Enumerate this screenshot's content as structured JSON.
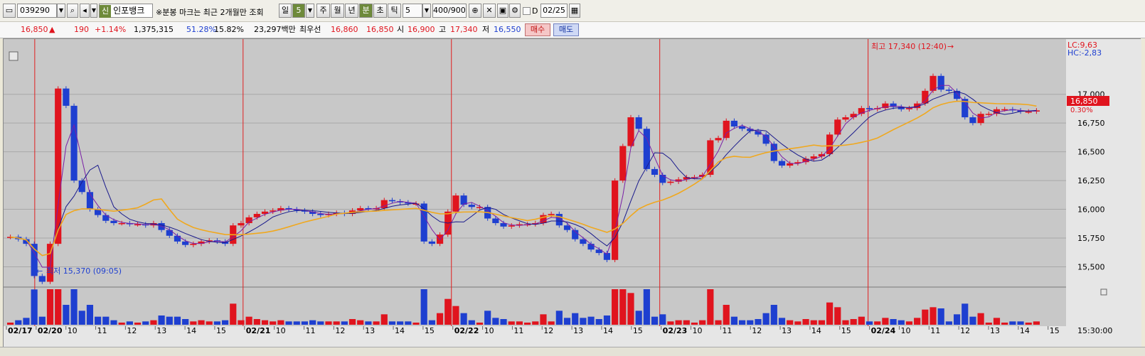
{
  "toolbar": {
    "code": "039290",
    "market_badge": "신",
    "stock_name": "인포뱅크",
    "notice": "※분봉 마크는 최근 2개월만 조회",
    "period_buttons": [
      "일",
      "5",
      "주",
      "월",
      "년",
      "분",
      "초",
      "틱"
    ],
    "interval_value": "5",
    "count_value": "400/900",
    "checkbox_label": "D",
    "date_value": "02/25"
  },
  "quote": {
    "price": "16,850",
    "change_arrow": "▲",
    "change": "190",
    "change_pct": "+1.14%",
    "volume": "1,375,315",
    "ratio1": "51.28%",
    "ratio2": "15.82%",
    "amount": "23,297백만",
    "best_label": "최우선",
    "best_ask": "16,860",
    "best_bid": "16,850",
    "open_label": "시",
    "open": "16,900",
    "high_label": "고",
    "high": "17,340",
    "low_label": "저",
    "low": "16,550",
    "buy_button": "매수",
    "sell_button": "매도"
  },
  "chart_labels": {
    "lc": "LC:9,63",
    "hc": "HC:-2,83",
    "current_price": "16,850",
    "current_pct": "0.30%",
    "max_annotation": "최고 17,340 (12:40)",
    "min_annotation": "최저 15,370 (09:05)",
    "time_end": "15:30:00"
  },
  "colors": {
    "up": "#e0141e",
    "down": "#1e3fd0",
    "ma_short": "#7a1fa6",
    "ma_mid": "#1a1a8c",
    "ma_long": "#f0a81e",
    "session_line": "#e02020",
    "background": "#c8c8c8"
  },
  "chart_data": {
    "type": "line",
    "title": "",
    "ylabel": "",
    "y_ticks": [
      "17,000",
      "16,750",
      "16,500",
      "16,250",
      "16,000",
      "15,750",
      "15,500"
    ],
    "ylim": [
      15330,
      17480
    ],
    "x_ticks": [
      "02/17",
      "02/20",
      "10",
      "11",
      "12",
      "13",
      "14",
      "15",
      "02/21",
      "10",
      "11",
      "12",
      "13",
      "14",
      "15",
      "02/22",
      "10",
      "11",
      "12",
      "13",
      "14",
      "15",
      "02/23",
      "10",
      "11",
      "12",
      "13",
      "14",
      "15",
      "02/24",
      "10",
      "11",
      "12",
      "13",
      "14",
      "15"
    ],
    "grid": true,
    "series": [
      {
        "values": [
          15760,
          15740,
          15700,
          15420,
          15370,
          15700,
          17050,
          16900,
          16250,
          16150,
          16000,
          15950,
          15900,
          15880,
          15880,
          15870,
          15870,
          15860,
          15880,
          15820,
          15770,
          15720,
          15690,
          15700,
          15720,
          15730,
          15720,
          15700,
          15860,
          15880,
          15930,
          15960,
          15980,
          15990,
          16010,
          16000,
          15990,
          15980,
          15960,
          15950,
          15960,
          15970,
          15960,
          15990,
          16010,
          16000,
          16010,
          16080,
          16070,
          16060,
          16050,
          16050,
          15720,
          15700,
          15780,
          15980,
          16120,
          16040,
          16020,
          16020,
          15920,
          15880,
          15850,
          15860,
          15870,
          15870,
          15880,
          15950,
          15960,
          15860,
          15820,
          15740,
          15700,
          15650,
          15620,
          15560,
          16250,
          16550,
          16800,
          16700,
          16350,
          16300,
          16230,
          16240,
          16260,
          16280,
          16280,
          16300,
          16600,
          16620,
          16770,
          16720,
          16700,
          16680,
          16650,
          16570,
          16420,
          16380,
          16400,
          16410,
          16440,
          16460,
          16480,
          16650,
          16780,
          16800,
          16830,
          16880,
          16870,
          16880,
          16920,
          16890,
          16870,
          16880,
          16920,
          17030,
          17160,
          17040,
          17030,
          16960,
          16800,
          16750,
          16830,
          16830,
          16870,
          16870,
          16860,
          16850,
          16850,
          16860
        ]
      }
    ]
  }
}
